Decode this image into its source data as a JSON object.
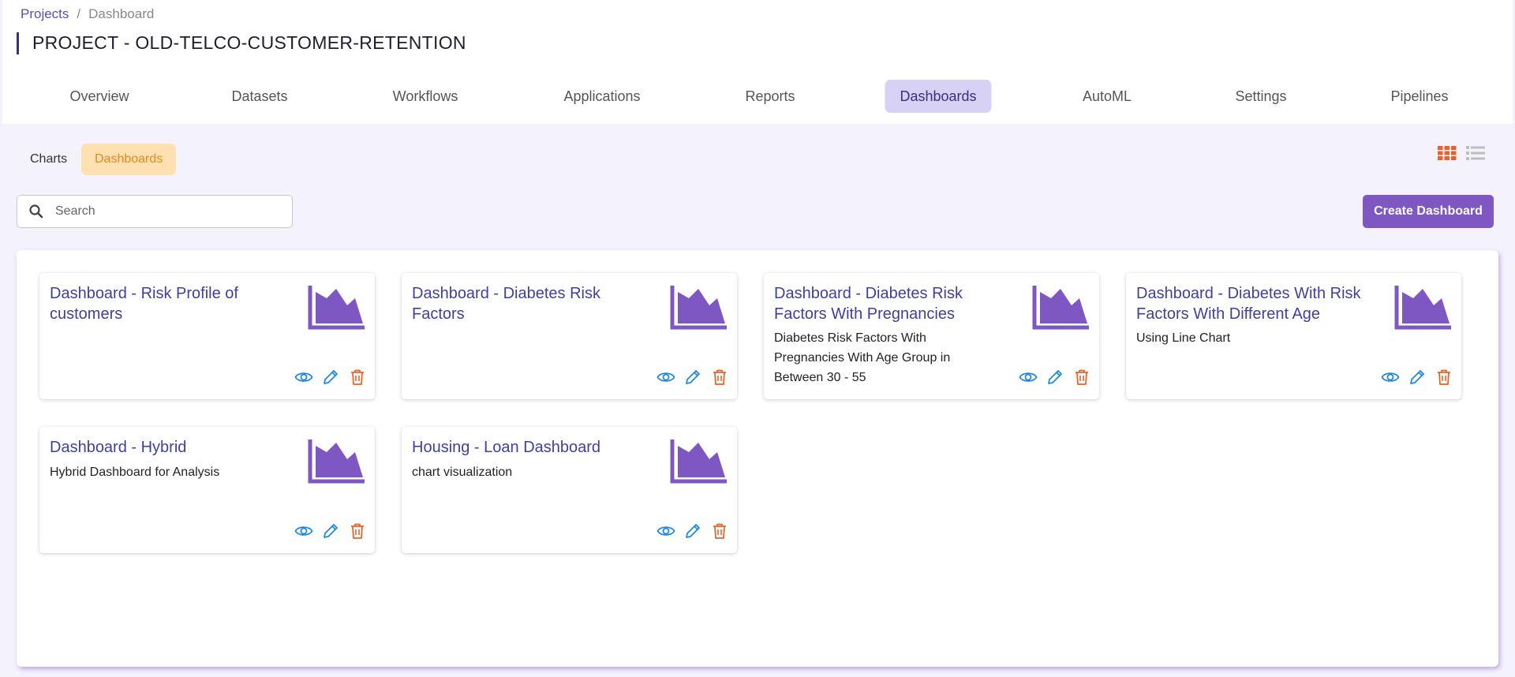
{
  "breadcrumb": {
    "root": "Projects",
    "separator": "/",
    "current": "Dashboard"
  },
  "project_title": "PROJECT - OLD-TELCO-CUSTOMER-RETENTION",
  "tabs": [
    {
      "label": "Overview"
    },
    {
      "label": "Datasets"
    },
    {
      "label": "Workflows"
    },
    {
      "label": "Applications"
    },
    {
      "label": "Reports"
    },
    {
      "label": "Dashboards",
      "active": true
    },
    {
      "label": "AutoML"
    },
    {
      "label": "Settings"
    },
    {
      "label": "Pipelines"
    }
  ],
  "subtabs": {
    "charts": "Charts",
    "dashboards": "Dashboards",
    "active": "Dashboards"
  },
  "view_toggle": {
    "grid_icon": "grid-icon",
    "list_icon": "list-icon",
    "active": "grid"
  },
  "search": {
    "placeholder": "Search",
    "value": ""
  },
  "create_button": "Create Dashboard",
  "colors": {
    "accent": "#7e57c2",
    "active_tab_bg": "#d7d1f5",
    "subtab_active_bg": "#ffe0b0",
    "subtab_active_text": "#e08a1e",
    "title_link": "#3f3f9f",
    "view_icon": "#1e88e5",
    "edit_icon": "#1e88e5",
    "delete_icon": "#e8632a"
  },
  "cards": [
    {
      "title": "Dashboard - Risk Profile of customers",
      "description": ""
    },
    {
      "title": "Dashboard - Diabetes Risk Factors",
      "description": ""
    },
    {
      "title": "Dashboard - Diabetes Risk Factors With Pregnancies",
      "description": "Diabetes Risk Factors With Pregnancies With Age Group in Between 30 - 55"
    },
    {
      "title": "Dashboard - Diabetes With Risk Factors With Different Age",
      "description": "Using Line Chart"
    },
    {
      "title": "Dashboard - Hybrid",
      "description": "Hybrid Dashboard for Analysis"
    },
    {
      "title": "Housing - Loan Dashboard",
      "description": "chart visualization"
    }
  ]
}
